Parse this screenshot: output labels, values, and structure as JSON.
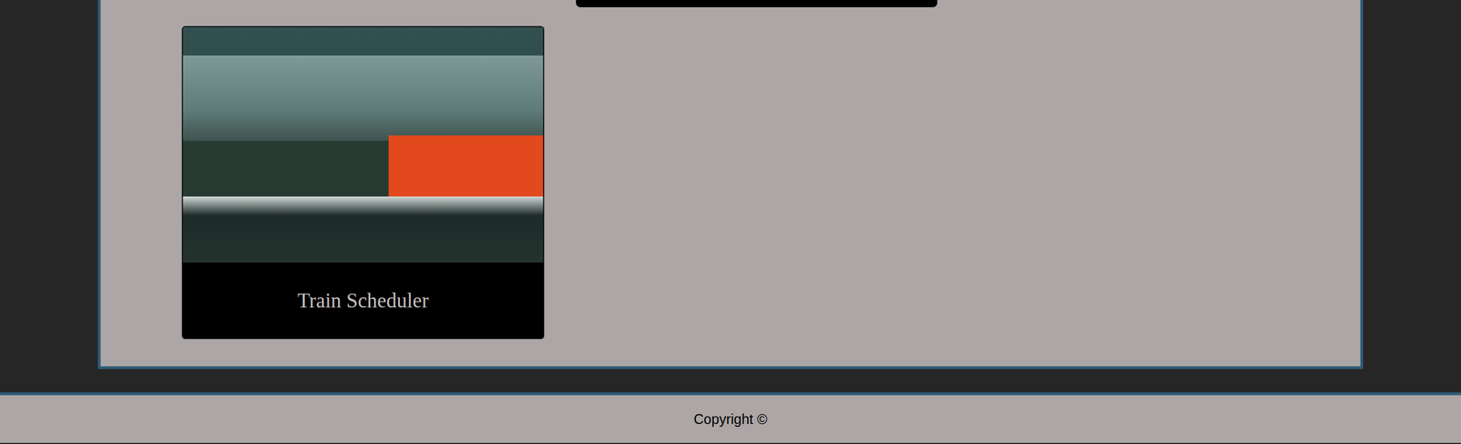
{
  "projects": [
    {
      "title": "Train Scheduler"
    }
  ],
  "footer": {
    "text": "Copyright ©"
  }
}
